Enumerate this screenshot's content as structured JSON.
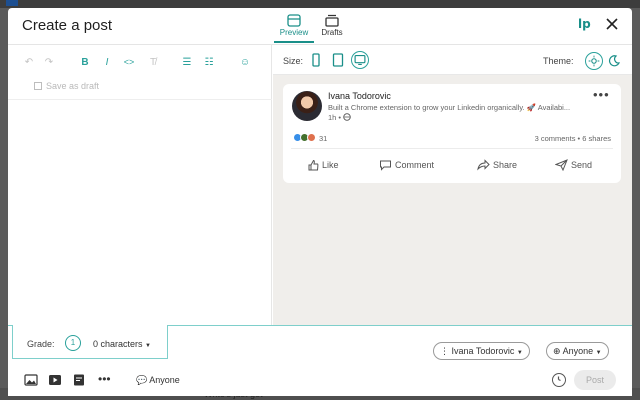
{
  "background": {
    "bottom_text": "Write's just got"
  },
  "header": {
    "title": "Create a post",
    "tabs": [
      {
        "label": "Preview",
        "active": true
      },
      {
        "label": "Drafts",
        "active": false
      }
    ],
    "brand": "lp"
  },
  "editor": {
    "toolbar": [
      "undo",
      "redo",
      "bold",
      "italic",
      "code",
      "clear-format",
      "bullet-list",
      "numbered-list",
      "emoji"
    ],
    "save_draft": "Save as draft"
  },
  "preview": {
    "size_label": "Size:",
    "theme_label": "Theme:",
    "post": {
      "author": "Ivana Todorovic",
      "headline": "Built a Chrome extension to grow your Linkedin organically. 🚀 Availabi...",
      "time": "1h •",
      "reactions": "31",
      "stats": "3 comments • 6 shares",
      "actions": [
        "Like",
        "Comment",
        "Share",
        "Send"
      ]
    }
  },
  "bottom": {
    "grade_label": "Grade:",
    "grade_value": "1",
    "characters": "0 characters",
    "author_select": "Ivana Todorovic",
    "visibility_select": "Anyone",
    "comment_visibility": "Anyone",
    "post_button": "Post"
  },
  "colors": {
    "accent": "#1a8f89",
    "light_accent": "#7ecfcb"
  }
}
